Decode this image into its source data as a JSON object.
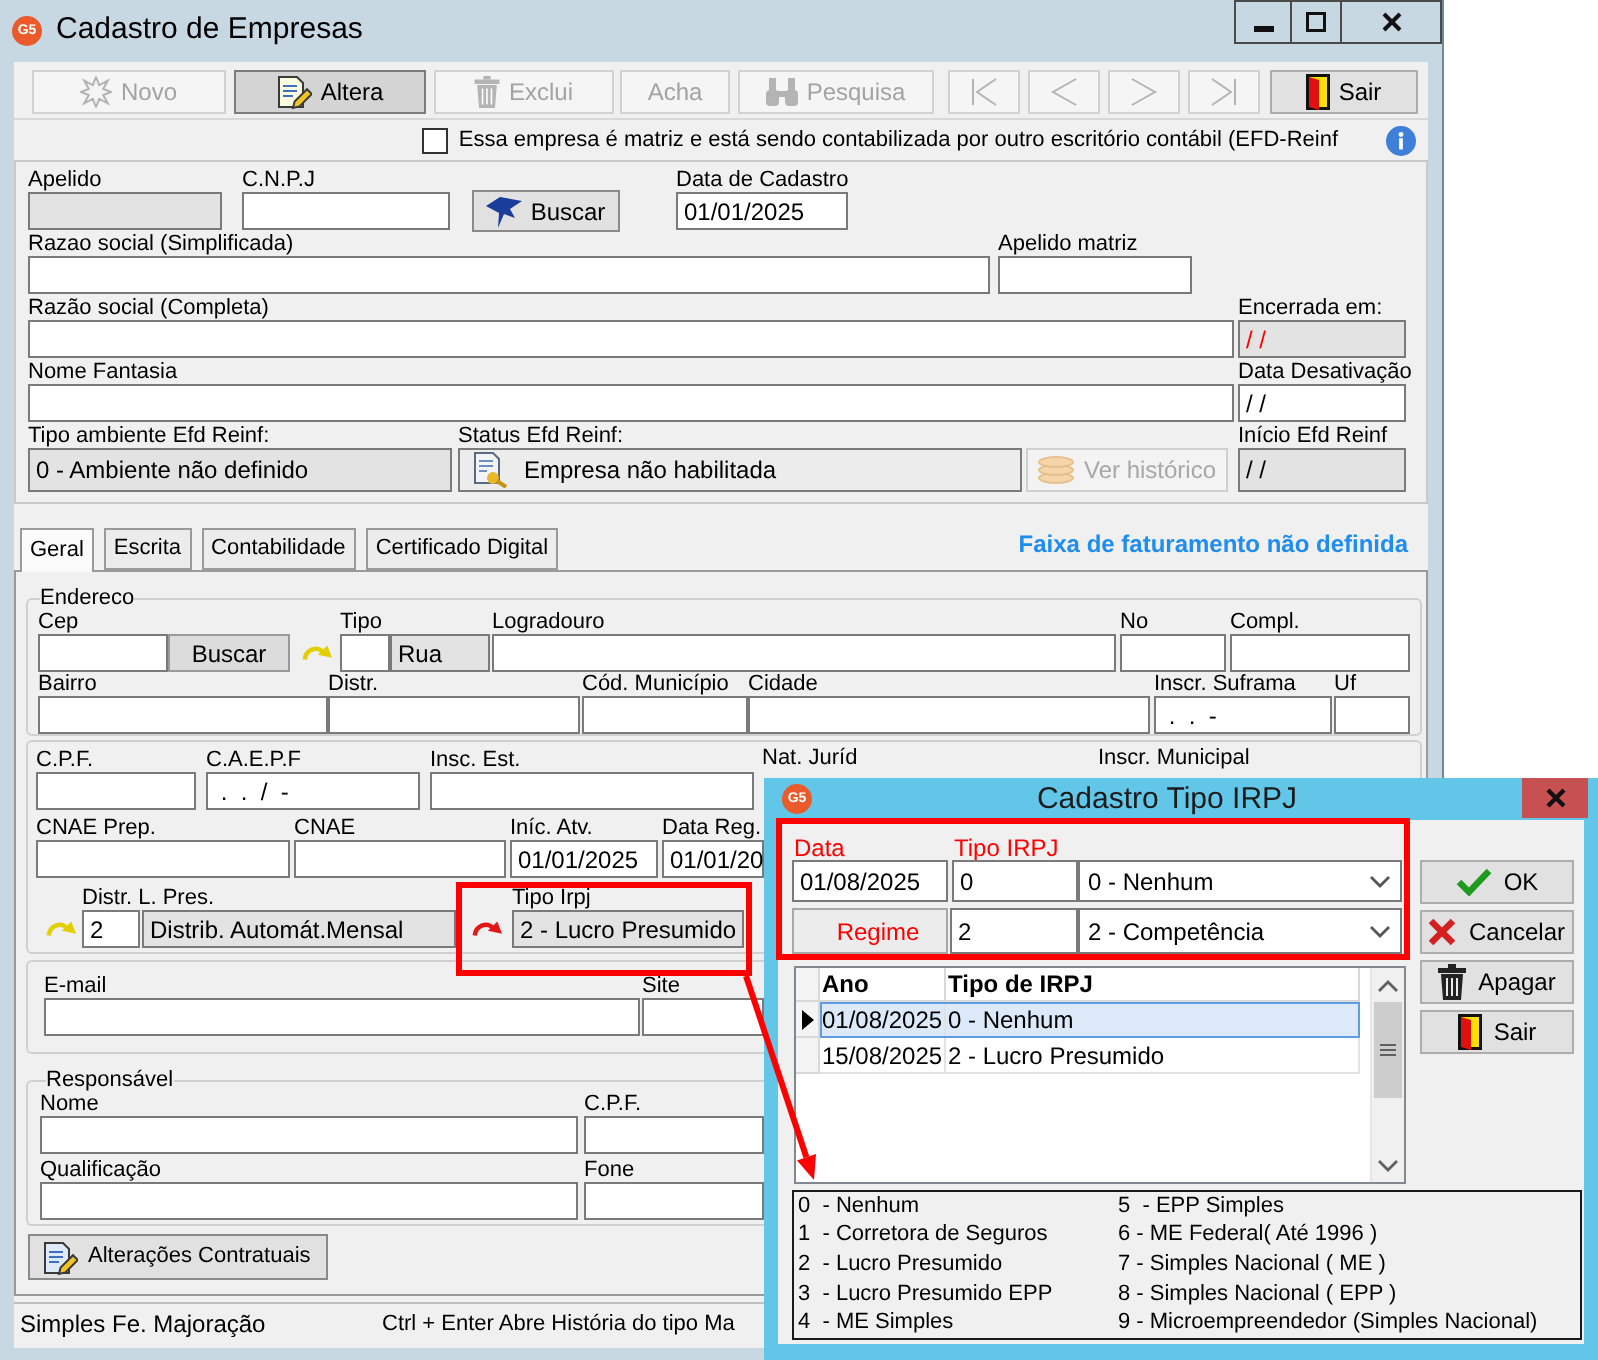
{
  "window": {
    "logo": "G5",
    "title": "Cadastro de Empresas"
  },
  "toolbar": [
    {
      "kind": "new",
      "label": "Novo",
      "disabled": true,
      "pressed": false
    },
    {
      "kind": "edit",
      "label": "Altera",
      "disabled": false,
      "pressed": true
    },
    {
      "kind": "delete",
      "label": "Exclui",
      "disabled": true,
      "pressed": false
    },
    {
      "kind": "find",
      "label": "Acha",
      "disabled": true,
      "pressed": false
    },
    {
      "kind": "search",
      "label": "Pesquisa",
      "disabled": true,
      "pressed": false
    },
    {
      "kind": "first",
      "disabled": true,
      "pressed": false
    },
    {
      "kind": "previous",
      "disabled": true,
      "pressed": false
    },
    {
      "kind": "next",
      "disabled": true,
      "pressed": false
    },
    {
      "kind": "last",
      "disabled": true,
      "pressed": false
    },
    {
      "kind": "exit",
      "label": "Sair",
      "disabled": false,
      "pressed": false
    }
  ],
  "matrix_checkbox": {
    "label": "Essa empresa é matriz e está sendo contabilizada por outro escritório contábil (EFD-Reinf",
    "checked": false
  },
  "company": {
    "apelido": {
      "label": "Apelido",
      "disabled": true
    },
    "cnpj": {
      "label": "C.N.P.J"
    },
    "cnpj_search": "Buscar",
    "data_cadastro": {
      "label": "Data de Cadastro",
      "value": "01/01/2025"
    },
    "razao_simplificada": {
      "label": "Razao social (Simplificada)"
    },
    "apelido_matriz": {
      "label": "Apelido matriz"
    },
    "razao_completa": {
      "label": "Razão social (Completa)"
    },
    "encerrada_em": {
      "label": "Encerrada em:",
      "value": "/ /",
      "disabled": true
    },
    "nome_fantasia": {
      "label": "Nome Fantasia"
    },
    "data_desativacao": {
      "label": "Data Desativação",
      "value": "/ /"
    },
    "tipo_ambiente": {
      "label": "Tipo ambiente Efd Reinf:",
      "value": "0 - Ambiente não definido",
      "disabled": true
    },
    "status_efd": {
      "label": "Status Efd Reinf:",
      "value": "Empresa não habilitada"
    },
    "history_button": {
      "label": "Ver histórico",
      "disabled": true
    },
    "inicio_efd": {
      "label": "Início Efd Reinf",
      "value": "/ /",
      "disabled": true
    }
  },
  "tabs": [
    {
      "label": "Geral",
      "selected": true
    },
    {
      "label": "Escrita",
      "selected": false
    },
    {
      "label": "Contabilidade",
      "selected": false
    },
    {
      "label": "Certificado Digital",
      "selected": false
    }
  ],
  "billing_notice": "Faixa de faturamento não definida",
  "address": {
    "title": "Endereco",
    "cep": {
      "label": "Cep"
    },
    "cep_search": "Buscar",
    "tipo": {
      "label": "Tipo"
    },
    "tipo_nome": {
      "value": "Rua",
      "disabled": true
    },
    "logradouro": {
      "label": "Logradouro"
    },
    "numero": {
      "label": "No"
    },
    "complemento": {
      "label": "Compl."
    },
    "bairro": {
      "label": "Bairro"
    },
    "distrito": {
      "label": "Distr."
    },
    "cod_municipio": {
      "label": "Cód. Município"
    },
    "cidade": {
      "label": "Cidade"
    },
    "suframa": {
      "label": "Inscr. Suframa",
      "value": " .  .  -"
    },
    "uf": {
      "label": "Uf"
    }
  },
  "registration": {
    "cpf": {
      "label": "C.P.F."
    },
    "caepf": {
      "label": "C.A.E.P.F",
      "value": " .  .  /  -"
    },
    "insc_est": {
      "label": "Insc. Est."
    },
    "nat_jurid": {
      "label": "Nat. Juríd"
    },
    "inscr_municipal": {
      "label": "Inscr. Municipal"
    },
    "cnae_prep": {
      "label": "CNAE Prep."
    },
    "cnae": {
      "label": "CNAE"
    },
    "inicio_atividade": {
      "label": "Iníc. Atv.",
      "value": "01/01/2025"
    },
    "data_registro": {
      "label": "Data Reg.",
      "value": "01/01/20"
    },
    "distr_l_pres": {
      "label": "Distr. L. Pres.",
      "code": {
        "value": "2"
      },
      "description": {
        "value": "Distrib. Automát.Mensal",
        "disabled": true
      }
    },
    "tipo_irpj": {
      "label": "Tipo Irpj",
      "value": "2 - Lucro Presumido",
      "disabled": true
    }
  },
  "contact": {
    "email": {
      "label": "E-mail"
    },
    "site": {
      "label": "Site"
    }
  },
  "responsible": {
    "title": "Responsável",
    "nome": {
      "label": "Nome"
    },
    "cpf": {
      "label": "C.P.F."
    },
    "qualificacao": {
      "label": "Qualificação"
    },
    "fone": {
      "label": "Fone"
    }
  },
  "contract_button": "Alterações Contratuais",
  "status_bar": [
    "Simples Fe. Majoração",
    "Ctrl + Enter Abre História do tipo Ma"
  ],
  "dialog": {
    "logo": "G5",
    "title": "Cadastro Tipo IRPJ",
    "data": {
      "label": "Data",
      "value": "01/08/2025"
    },
    "tipo_irpj": {
      "label": "Tipo IRPJ",
      "code": "0",
      "option": "0 - Nenhum"
    },
    "regime": {
      "label": "Regime",
      "code": "2",
      "option": "2 - Competência"
    },
    "buttons": [
      {
        "kind": "ok",
        "label": "OK"
      },
      {
        "kind": "cancel",
        "label": "Cancelar"
      },
      {
        "kind": "delete",
        "label": "Apagar"
      },
      {
        "kind": "exit",
        "label": "Sair"
      }
    ],
    "grid": {
      "columns": [
        "Ano",
        "Tipo de IRPJ"
      ],
      "rows": [
        {
          "selected": true,
          "cells": [
            "01/08/2025",
            "0 - Nenhum"
          ]
        },
        {
          "selected": false,
          "cells": [
            "15/08/2025",
            "2 - Lucro Presumido"
          ]
        }
      ]
    },
    "legend": [
      "0  - Nenhum",
      "1  - Corretora de Seguros",
      "2  - Lucro Presumido",
      "3  - Lucro Presumido EPP",
      "4  - ME Simples",
      "5  - EPP Simples",
      "6 - ME Federal( Até 1996 )",
      "7 - Simples Nacional ( ME )",
      "8 - Simples Nacional ( EPP )",
      "9 - Microempreendedor (Simples Nacional)"
    ]
  }
}
